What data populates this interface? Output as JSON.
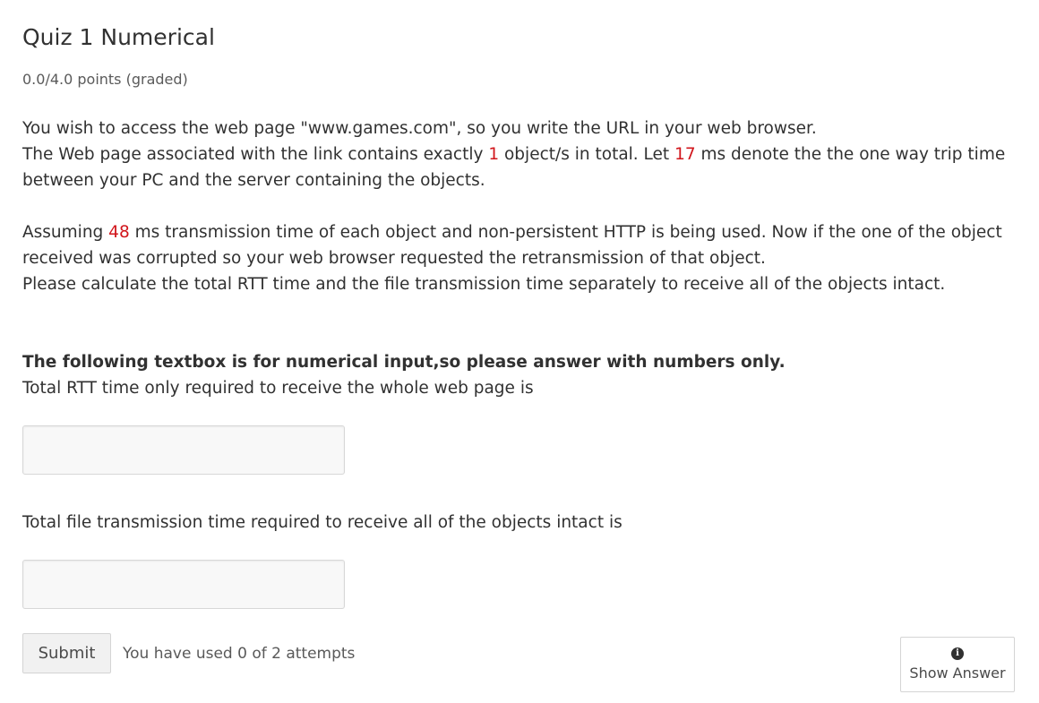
{
  "problem": {
    "title": "Quiz 1 Numerical",
    "points": "0.0/4.0 points (graded)",
    "paragraph1": {
      "line1": "You wish to access the web page \"www.games.com\", so you write the URL in your web browser.",
      "line2_a": "The Web page associated with the link contains exactly ",
      "object_count": "1",
      "line2_b": " object/s in total. Let ",
      "one_way_time": "17",
      "line2_c": " ms denote the the one way trip time between your PC and the server containing the objects."
    },
    "paragraph2": {
      "line1_a": "Assuming ",
      "transmission_time": "48",
      "line1_b": " ms transmission time of each object and non-persistent HTTP is being used. Now if the one of the object received was corrupted so your web browser requested the retransmission of that object.",
      "line2": "Please calculate the total RTT time and the file transmission time separately to receive all of the objects intact."
    },
    "instruction": "The following textbox is for numerical input,so please answer with numbers only.",
    "question1_label": "Total RTT time only required to receive the whole web page is",
    "question1_value": "",
    "question2_label": "Total file transmission time required to receive all of the objects intact is",
    "question2_value": ""
  },
  "actions": {
    "submit_label": "Submit",
    "attempts_text": "You have used 0 of 2 attempts",
    "show_answer_label": "Show Answer",
    "show_answer_icon": "info-icon"
  },
  "colors": {
    "highlight": "#d1151b",
    "text": "#313131"
  }
}
